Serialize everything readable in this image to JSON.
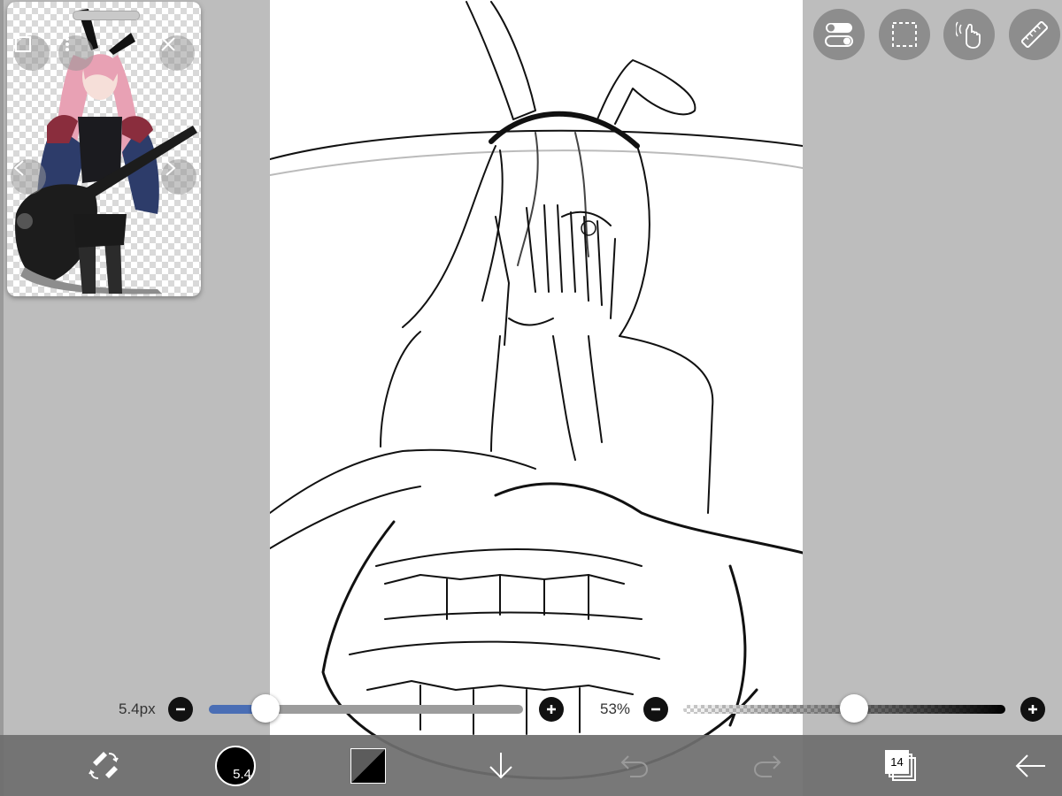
{
  "reference_window": {
    "icons": [
      "fit-icon",
      "more-icon",
      "close-icon",
      "prev-icon",
      "next-icon"
    ]
  },
  "top_tools": {
    "icons": [
      "toggle-icon",
      "selection-icon",
      "gesture-icon",
      "ruler-icon"
    ]
  },
  "brush_size": {
    "label": "5.4px",
    "fraction": 0.18
  },
  "opacity": {
    "label": "53%",
    "fraction": 0.53
  },
  "toolbar": {
    "brush_size_value": "5.4",
    "layer_count": "14",
    "icons": [
      "tool-swap-icon",
      "brush-size-icon",
      "color-icon",
      "import-icon",
      "undo-icon",
      "redo-icon",
      "layers-icon",
      "back-arrow-icon"
    ]
  },
  "colors": {
    "slider_fill": "#4a6eb5",
    "toolbar_bg": "#6e6e6e",
    "tool_button": "#8d8d8d"
  }
}
